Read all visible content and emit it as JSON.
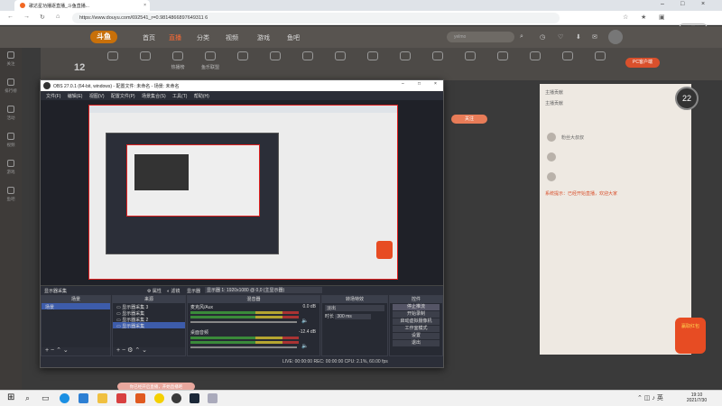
{
  "browser": {
    "tab_title": "歌达星功播逐直播_斗鱼直播...",
    "url": "https://www.douyu.com/692541_r=0.9814866897649311 6",
    "wait_label": "未同步"
  },
  "douyu": {
    "logo": "斗鱼",
    "nav": [
      "首页",
      "直播",
      "分类",
      "视频",
      "游戏",
      "鱼吧"
    ],
    "search_placeholder": "yelmo",
    "categories": [
      "",
      "",
      "热播榜",
      "鱼乐联盟",
      "",
      "",
      "",
      "",
      "",
      "",
      "",
      "",
      "",
      "",
      "",
      "",
      "",
      "",
      "",
      "",
      "",
      "",
      "",
      "",
      "",
      "",
      ""
    ],
    "viewer_count": "12",
    "pc_client_label": "PC客户端",
    "follow_label": "关注",
    "left_items": [
      "关注",
      "排行榜",
      "活动",
      "视频",
      "游戏",
      "鱼吧"
    ],
    "chat_rows": [
      "主播贡献",
      "主播贡献",
      "",
      "",
      "系统提示：已经开始直播，欢迎大家",
      "粉丝大叔叔",
      "",
      ""
    ],
    "gauge_value": "22",
    "red_packet": "赢取红包"
  },
  "obs": {
    "title": "OBS 27.0.1 (64-bit, windows) - 配置文件: 未命名 - 场景: 未命名",
    "menu": [
      "文件(F)",
      "编辑(E)",
      "视图(V)",
      "配置文件(P)",
      "场景集合(S)",
      "工具(T)",
      "帮助(H)"
    ],
    "source_bar": [
      "显示器采集",
      "属性",
      "滤镜",
      "显示器",
      "显示器 1: 1920x1080 @ 0,0 (主显示器)"
    ],
    "scenes_header": "场景",
    "scenes": [
      "场景"
    ],
    "sources_header": "来源",
    "sources": [
      "显示器采集 3",
      "显示器采集",
      "显示器采集 2",
      "显示器采集"
    ],
    "mixer_header": "混音器",
    "mixer": [
      {
        "name": "麦克风/Aux",
        "db": "0.0 dB"
      },
      {
        "name": "桌面音频",
        "db": "-12.4 dB"
      }
    ],
    "transition_header": "转场特效",
    "transition": "淡出",
    "duration_label": "时长",
    "duration": "300 ms",
    "controls_header": "控件",
    "controls": [
      "停止推流",
      "开始录制",
      "启动虚拟摄像机",
      "工作室模式",
      "设置",
      "退出"
    ],
    "status": "LIVE: 00:00:00   REC: 00:00:00   CPU: 2.1%, 60.00 fps"
  },
  "taskbar": {
    "time": "19:10",
    "date": "2021/7/30",
    "toast": "你已经开启直播，开始直播吧"
  }
}
